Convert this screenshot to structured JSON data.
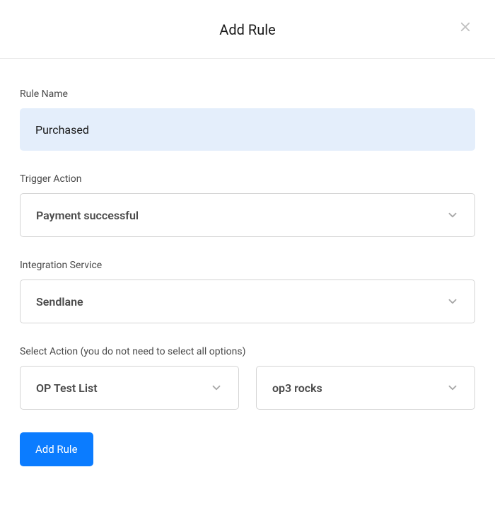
{
  "header": {
    "title": "Add Rule"
  },
  "form": {
    "ruleName": {
      "label": "Rule Name",
      "value": "Purchased"
    },
    "triggerAction": {
      "label": "Trigger Action",
      "value": "Payment successful"
    },
    "integrationService": {
      "label": "Integration Service",
      "value": "Sendlane"
    },
    "selectAction": {
      "label": "Select Action (you do not need to select all options)",
      "option1": "OP Test List",
      "option2": "op3 rocks"
    }
  },
  "buttons": {
    "submit": "Add Rule"
  }
}
